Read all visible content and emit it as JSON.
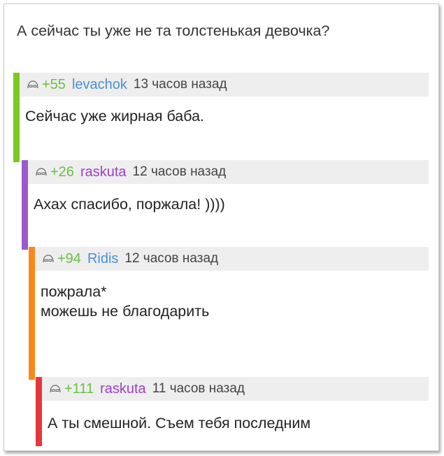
{
  "post": {
    "title": "А сейчас ты уже не та толстенькая девочка?"
  },
  "colors": {
    "score": "#6abf45",
    "user_blue": "#4a8fd8",
    "user_purple": "#9d3fc9",
    "bar_green": "#7cc91f",
    "bar_purple": "#9c59cc",
    "bar_orange": "#f7891c",
    "bar_red": "#e5363c"
  },
  "comments": [
    {
      "score": "+55",
      "user": "levachok",
      "time": "13 часов назад",
      "text": "Сейчас уже жирная баба.",
      "icon": "reader-face-icon"
    },
    {
      "score": "+26",
      "user": "raskuta",
      "time": "12 часов назад",
      "text": "Ахах спасибо, поржала! ))))",
      "icon": "reader-face-icon"
    },
    {
      "score": "+94",
      "user": "Ridis",
      "time": "12 часов назад",
      "text_lines": [
        "пожрала*",
        "можешь не благодарить"
      ],
      "icon": "reader-face-icon"
    },
    {
      "score": "+111",
      "user": "raskuta",
      "time": "11 часов назад",
      "text": "А ты смешной. Съем тебя последним",
      "icon": "reader-face-icon"
    }
  ]
}
